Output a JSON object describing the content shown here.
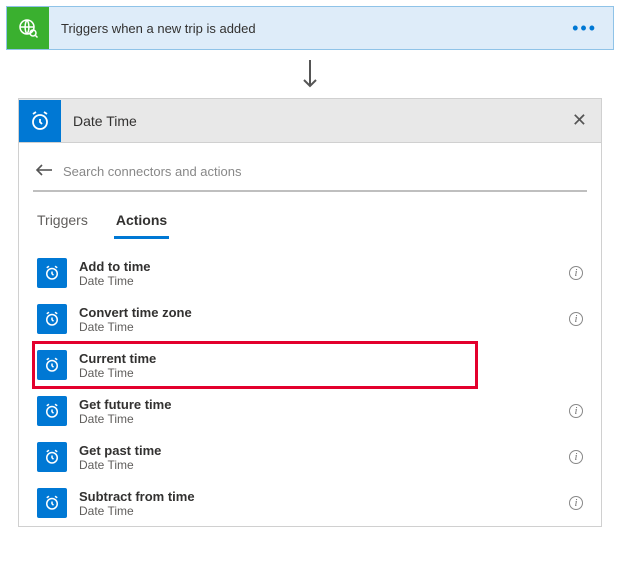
{
  "trigger": {
    "title": "Triggers when a new trip is added"
  },
  "panel": {
    "title": "Date Time",
    "search_placeholder": "Search connectors and actions"
  },
  "tabs": {
    "triggers": "Triggers",
    "actions": "Actions"
  },
  "actions": [
    {
      "title": "Add to time",
      "sub": "Date Time"
    },
    {
      "title": "Convert time zone",
      "sub": "Date Time"
    },
    {
      "title": "Current time",
      "sub": "Date Time"
    },
    {
      "title": "Get future time",
      "sub": "Date Time"
    },
    {
      "title": "Get past time",
      "sub": "Date Time"
    },
    {
      "title": "Subtract from time",
      "sub": "Date Time"
    }
  ]
}
